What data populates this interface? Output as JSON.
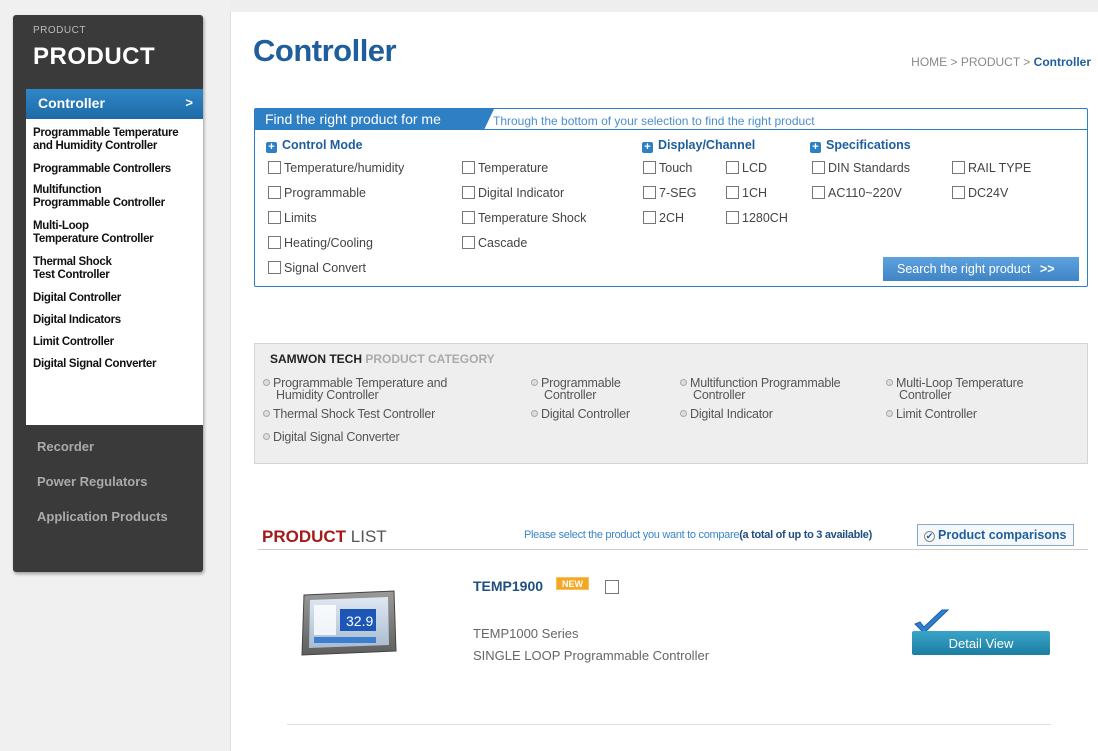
{
  "sidebar": {
    "section_small": "PRODUCT",
    "section_title": "PRODUCT",
    "active_item": "Controller",
    "active_arrow": ">",
    "subitems": [
      "Programmable Temperature",
      "and Humidity Controller",
      "Programmable Controllers",
      "Multifunction",
      "Programmable Controller",
      "Multi-Loop",
      "Temperature Controller",
      "Thermal Shock",
      "Test Controller",
      "Digital Controller",
      "Digital Indicators",
      "Limit Controller",
      "Digital Signal Converter"
    ],
    "main_items": [
      "Recorder",
      "Power Regulators",
      "Application Products"
    ]
  },
  "header": {
    "title": "Controller",
    "breadcrumb": {
      "home": "HOME",
      "sep1": " > ",
      "product": "PRODUCT",
      "sep2": " > ",
      "current": "Controller"
    }
  },
  "filter": {
    "tab_label": "Find the right product for me",
    "description": "Through the bottom of your selection to find the right product",
    "groups": {
      "control_mode": "Control Mode",
      "display_channel": "Display/Channel",
      "specifications": "Specifications"
    },
    "options": {
      "temp_humidity": "Temperature/humidity",
      "temperature": "Temperature",
      "touch": "Touch",
      "lcd": "LCD",
      "din": "DIN Standards",
      "rail": "RAIL TYPE",
      "programmable": "Programmable",
      "digital_indicator": "Digital Indicator",
      "seg7": "7-SEG",
      "ch1": "1CH",
      "ac": "AC110~220V",
      "dc": "DC24V",
      "limits": "Limits",
      "temp_shock": "Temperature Shock",
      "ch2": "2CH",
      "ch1280": "1280CH",
      "heating_cooling": "Heating/Cooling",
      "cascade": "Cascade",
      "signal_convert": "Signal Convert"
    },
    "search_button": "Search the right product",
    "search_icon": "double-chevron-right-icon",
    "search_glyph": ">>"
  },
  "category": {
    "brand": "SAMWON TECH",
    "title": "PRODUCT CATEGORY",
    "items": {
      "prog_temp_1": "Programmable Temperature and",
      "prog_temp_2": "Humidity Controller",
      "prog_1": "Programmable",
      "prog_2": "Controller",
      "multi_1": "Multifunction Programmable",
      "multi_2": "Controller",
      "multiloop_1": "Multi-Loop Temperature",
      "multiloop_2": "Controller",
      "thermal": "Thermal Shock Test Controller",
      "digital_controller": "Digital Controller",
      "digital_indicator": "Digital Indicator",
      "limit": "Limit Controller",
      "signal": "Digital Signal Converter"
    }
  },
  "product_list": {
    "title_bold": "PRODUCT",
    "title_light": " LIST",
    "note": "Please select the product you want to compare",
    "note_bold": "(a total of up to 3 available)",
    "compare_button": "Product comparisons",
    "compare_glyph": "✔"
  },
  "product": {
    "name": "TEMP1900",
    "badge": "NEW",
    "display_value": "32.9",
    "series": "TEMP1000 Series",
    "description": "SINGLE LOOP Programmable Controller",
    "detail_button": "Detail View"
  },
  "colors": {
    "brand_blue": "#1f5e9c",
    "accent_blue": "#2f7fc4",
    "sidebar_dark": "#3a3a3a",
    "list_red": "#a51a1a",
    "badge_orange": "#f5a623",
    "detail_teal": "#1b7ea2"
  }
}
